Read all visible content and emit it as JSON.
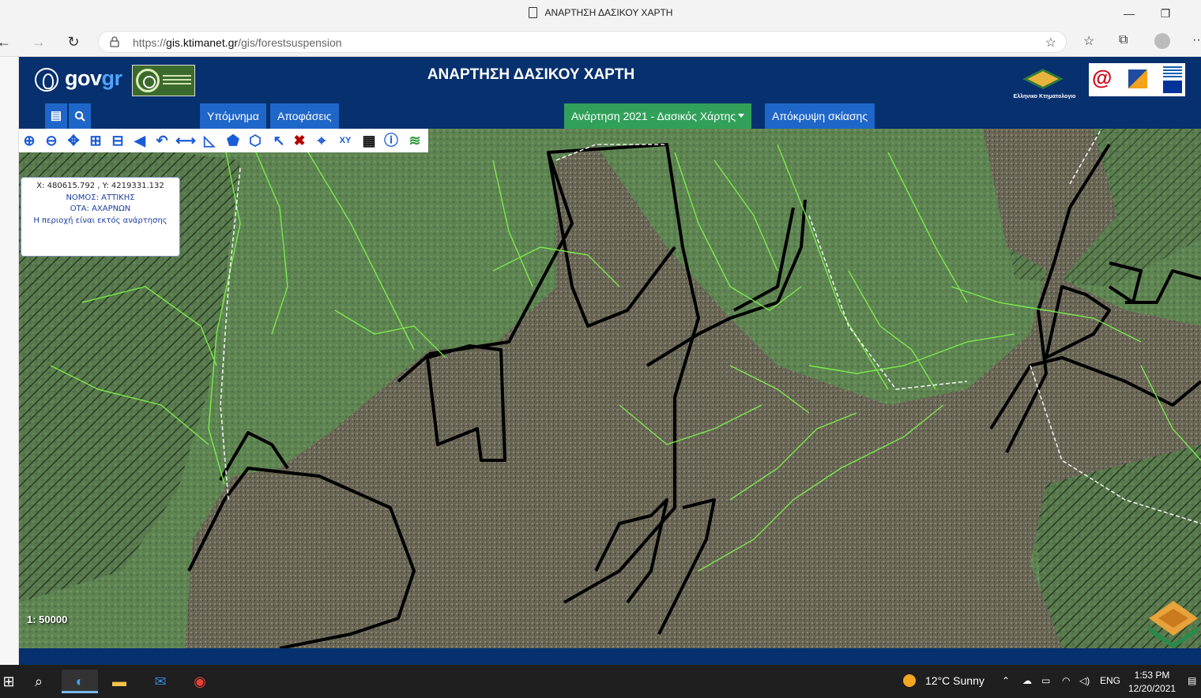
{
  "browser": {
    "tab_title": "ΑΝΑΡΤΗΣΗ ΔΑΣΙΚΟΥ ΧΑΡΤΗ",
    "url_prefix": "https://",
    "url_domain": "gis.ktimanet.gr",
    "url_path": "/gis/forestsuspension",
    "minimize": "—",
    "maximize": "❐",
    "back": "←",
    "forward": "→",
    "reload": "↻",
    "more": "···"
  },
  "header": {
    "gov_logo_text_1": "gov",
    "gov_logo_text_2": "gr",
    "app_title": "ΑΝΑΡΤΗΣΗ ΔΑΣΙΚΟΥ ΧΑΡΤΗ",
    "ktima_logo_text": "Ελληνικο Κτηματολογιο"
  },
  "menubar": {
    "legend_label": "Υπόμνημα",
    "decisions_label": "Αποφάσεις",
    "posting_dropdown_label": "Ανάρτηση 2021 - Δασικός Χάρτης",
    "hide_shading_label": "Απόκρυψη σκίασης"
  },
  "map": {
    "info": {
      "coords": "X: 480615.792 , Y: 4219331.132",
      "nomos": "ΝΟΜΟΣ: ΑΤΤΙΚΗΣ",
      "ota": "ΟΤΑ: ΑΧΑΡΝΩΝ",
      "status": "Η περιοχή είναι εκτός ανάρτησης"
    },
    "scale": "1: 50000",
    "tools": [
      "zoom-in",
      "zoom-out",
      "pan",
      "zoom-box",
      "zoom-extent",
      "previous-extent",
      "next-extent",
      "measure-distance",
      "measure-area",
      "draw-polygon",
      "select-polygon",
      "select",
      "clear",
      "identify-point",
      "goto-xy",
      "print",
      "info",
      "layers"
    ]
  },
  "taskbar": {
    "weather": "12°C  Sunny",
    "lang": "ENG",
    "time": "1:53 PM",
    "date": "12/20/2021"
  },
  "colors": {
    "header_bg": "#06306e",
    "button_blue": "#1f66c9",
    "button_green": "#31a15a",
    "forest_line": "#7cf04a"
  }
}
